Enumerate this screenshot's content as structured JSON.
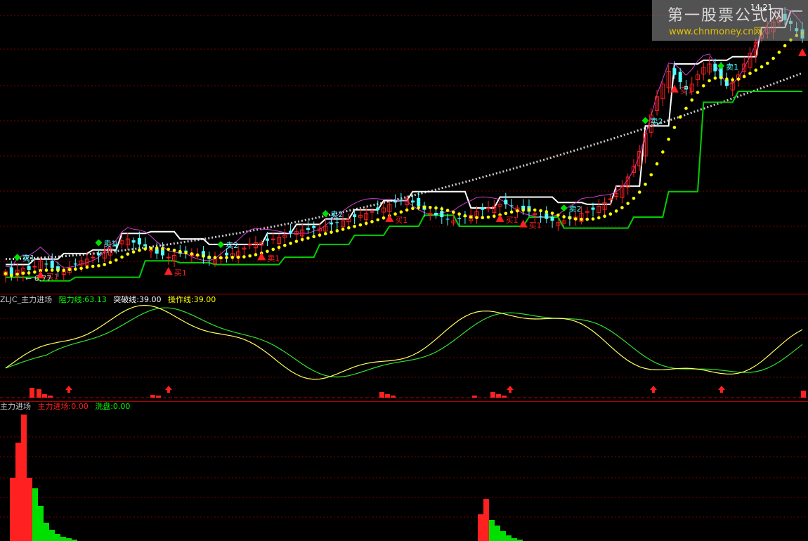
{
  "watermark": {
    "site_name": "第一股票公式网",
    "url": "www.chnmoney.cn网",
    "time": "14.21"
  },
  "colors": {
    "up": "#ff2020",
    "down": "#54ffff",
    "support": "#00d000",
    "resist": "#ffffff",
    "avg": "#ffff00",
    "trend": "#c8c8c8",
    "fast": "#ffff60",
    "slow": "#30e030",
    "band": "#d040d0"
  },
  "panes": {
    "price": {
      "low_label": "← 6.77"
    },
    "indicator": {
      "name": "ZLJC_主力进场",
      "items": [
        {
          "label": "阻力线:63.13",
          "color": "#00ff00"
        },
        {
          "label": "突破线:39.00",
          "color": "#ffffff"
        },
        {
          "label": "操作线:39.00",
          "color": "#ffff00"
        }
      ]
    },
    "volume": {
      "name": "主力进场",
      "items": [
        {
          "label": "主力进场:0.00",
          "color": "#ff2020"
        },
        {
          "label": "洗盘:0.00",
          "color": "#00ff00"
        }
      ]
    }
  },
  "signals": [
    {
      "text": "卖1",
      "type": "sell",
      "index": 3,
      "color": "#54ffff"
    },
    {
      "text": "买1",
      "type": "buy",
      "index": 10,
      "color": "#ff2020"
    },
    {
      "text": "卖1",
      "type": "sell",
      "index": 24,
      "color": "#54ffff"
    },
    {
      "text": "买1",
      "type": "buy",
      "index": 44,
      "color": "#ff2020"
    },
    {
      "text": "卖2",
      "type": "sell",
      "index": 58,
      "color": "#54ffff"
    },
    {
      "text": "卖1",
      "type": "buy",
      "index": 68,
      "color": "#ff2020"
    },
    {
      "text": "卖2",
      "type": "sell",
      "index": 85,
      "color": "#54ffff"
    },
    {
      "text": "买1",
      "type": "buy",
      "index": 102,
      "color": "#ff2020"
    },
    {
      "text": "卖2",
      "type": "sell",
      "index": 148,
      "color": "#54ffff"
    },
    {
      "text": "买1",
      "type": "buy",
      "index": 132,
      "color": "#ff2020"
    },
    {
      "text": "买1",
      "type": "buy",
      "index": 138,
      "color": "#ff2020"
    },
    {
      "text": "卖2",
      "type": "sell",
      "index": 170,
      "color": "#54ffff"
    },
    {
      "text": "买1",
      "type": "buy",
      "index": 178,
      "color": "#ff2020"
    },
    {
      "text": "卖1",
      "type": "sell",
      "index": 190,
      "color": "#54ffff"
    },
    {
      "text": "买1",
      "type": "buy",
      "index": 212,
      "color": "#ff2020"
    }
  ],
  "chart_data": [
    {
      "type": "line",
      "title": "",
      "close": [
        7.2,
        7.0,
        7.3,
        7.4,
        7.3,
        7.5,
        7.8,
        7.6,
        7.4,
        7.3,
        7.2,
        7.4,
        7.6,
        7.8,
        7.9,
        8.0,
        8.1,
        8.3,
        8.5,
        8.6,
        8.9,
        9.0,
        8.8,
        8.7,
        8.6,
        8.4,
        8.2,
        8.1,
        8.0,
        8.1,
        8.2,
        8.3,
        8.2,
        8.1,
        8.0,
        7.9,
        7.9,
        8.0,
        8.1,
        8.2,
        8.3,
        8.5,
        8.7,
        8.8,
        8.8,
        8.9,
        9.0,
        9.1,
        9.2,
        9.3,
        9.4,
        9.5,
        9.5,
        9.6,
        9.6,
        9.7,
        9.8,
        9.9,
        10.0,
        10.1,
        10.2,
        10.3,
        10.4,
        10.5,
        10.6,
        10.7,
        10.9,
        11.0,
        11.1,
        11.2,
        11.0,
        10.8,
        10.6,
        10.4,
        10.3,
        10.2,
        10.1,
        10.0,
        10.1,
        10.2,
        10.3,
        10.5,
        10.6,
        10.7,
        10.8,
        10.9,
        10.9,
        10.8,
        10.7,
        10.6,
        10.5,
        10.4,
        10.2,
        10.1,
        10.0,
        9.9,
        10.0,
        10.1,
        10.2,
        10.4,
        10.5,
        10.6,
        10.8,
        11.0,
        11.2,
        11.5,
        11.9,
        12.4,
        13.0,
        13.8,
        14.8,
        15.8,
        16.8,
        17.5,
        18.2,
        18.0,
        17.6,
        17.2,
        17.5,
        18.0,
        18.4,
        18.6,
        18.2,
        17.8,
        17.4,
        17.6,
        18.0,
        18.6,
        19.2,
        19.8,
        20.2,
        20.6,
        20.9,
        21.1,
        21.0,
        20.8,
        20.4,
        20.0
      ],
      "ma_line": "yellow dotted moving average",
      "support_line": "green step line",
      "resistance_line": "white step line",
      "trend_line": "grey dashed rising line",
      "low_marker": 6.77
    },
    {
      "type": "line",
      "title": "ZLJC_主力进场",
      "series": [
        {
          "name": "阻力线",
          "value": 63.13
        },
        {
          "name": "突破线",
          "value": 39.0
        },
        {
          "name": "操作线",
          "value": 39.0
        }
      ]
    },
    {
      "type": "bar",
      "title": "主力进场",
      "series": [
        {
          "name": "主力进场",
          "value": 0.0
        },
        {
          "name": "洗盘",
          "value": 0.0
        }
      ]
    }
  ]
}
